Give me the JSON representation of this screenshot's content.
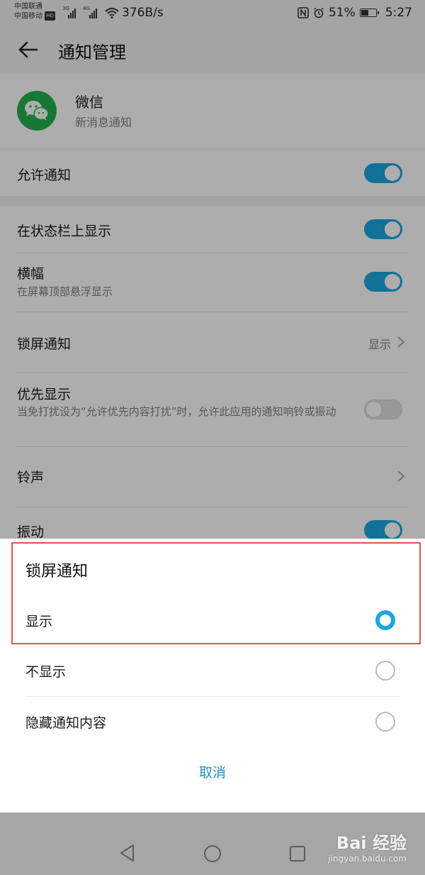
{
  "status_bar": {
    "carrier1": "中国联通",
    "carrier2": "中国移动",
    "hd": "HD",
    "sig1": "3G",
    "sig2": "4G",
    "net_speed": "376B/s",
    "battery": "51%",
    "battery_level": 0.51,
    "time": "5:27"
  },
  "app_bar": {
    "title": "通知管理"
  },
  "app": {
    "name": "微信",
    "subtitle": "新消息通知"
  },
  "settings": {
    "allow": {
      "label": "允许通知",
      "on": true
    },
    "status_bar": {
      "label": "在状态栏上显示",
      "on": true
    },
    "banner": {
      "label": "横幅",
      "sub": "在屏幕顶部悬浮显示",
      "on": true
    },
    "lock_screen": {
      "label": "锁屏通知",
      "value": "显示"
    },
    "priority": {
      "label": "优先显示",
      "sub": "当免打扰设为“允许优先内容打扰”时，允许此应用的通知响铃或振动",
      "on": false
    },
    "ringtone": {
      "label": "铃声"
    },
    "vibrate": {
      "label": "振动",
      "on": true
    }
  },
  "sheet": {
    "title": "锁屏通知",
    "options": [
      {
        "label": "显示",
        "selected": true
      },
      {
        "label": "不显示",
        "selected": false
      },
      {
        "label": "隐藏通知内容",
        "selected": false
      }
    ],
    "cancel": "取消"
  },
  "watermark": {
    "main": "Bai 经验",
    "sub": "jingyan.baidu.com"
  },
  "colors": {
    "accent": "#1aa7e0",
    "wechat_green": "#23b14d",
    "highlight_red": "#d9534f"
  }
}
